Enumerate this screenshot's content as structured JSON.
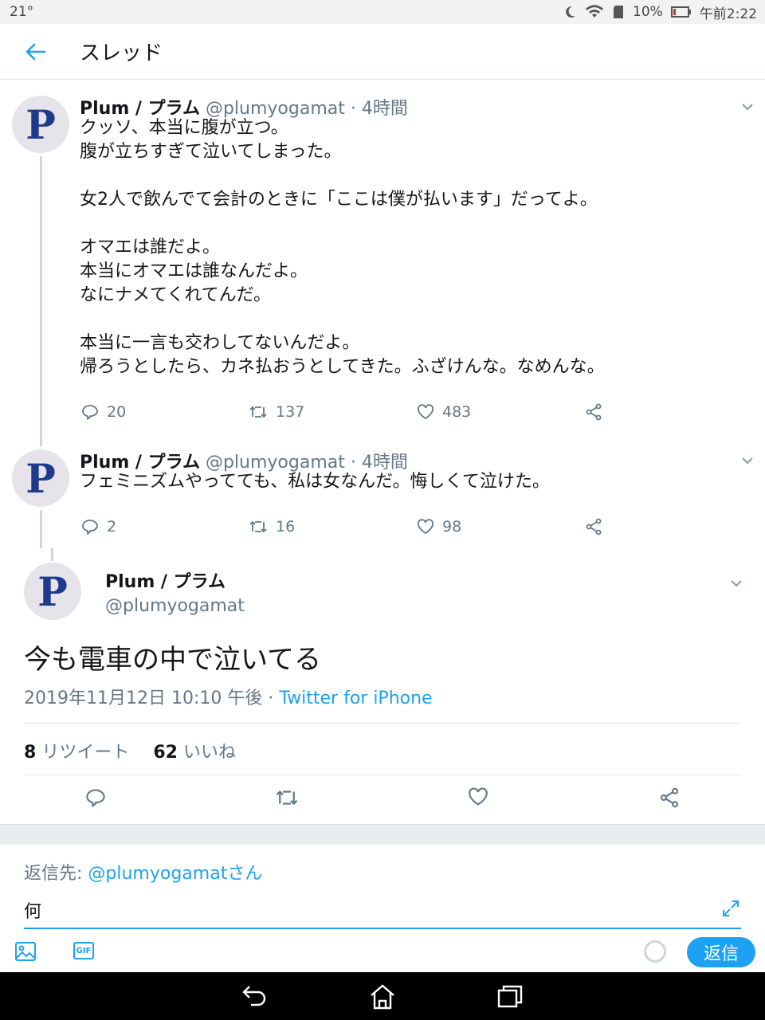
{
  "status_bar": {
    "temperature": "21°",
    "battery": "10%",
    "time": "午前2:22"
  },
  "header": {
    "title": "スレッド"
  },
  "colors": {
    "accent": "#1da1f2",
    "text": "#14171a",
    "muted": "#657786",
    "border": "#e1e8ed"
  },
  "tweets": [
    {
      "avatar_letter": "P",
      "name": "Plum / プラム",
      "handle": "@plumyogamat",
      "time": "· 4時間",
      "text": "クッソ、本当に腹が立つ。\n腹が立ちすぎて泣いてしまった。\n\n女2人で飲んでて会計のときに「ここは僕が払います」だってよ。\n\nオマエは誰だよ。\n本当にオマエは誰なんだよ。\nなにナメてくれてんだ。\n\n本当に一言も交わしてないんだよ。\n帰ろうとしたら、カネ払おうとしてきた。ふざけんな。なめんな。",
      "replies": "20",
      "retweets": "137",
      "likes": "483"
    },
    {
      "avatar_letter": "P",
      "name": "Plum / プラム",
      "handle": "@plumyogamat",
      "time": "· 4時間",
      "text": "フェミニズムやってても、私は女なんだ。悔しくて泣けた。",
      "replies": "2",
      "retweets": "16",
      "likes": "98"
    }
  ],
  "focused": {
    "avatar_letter": "P",
    "name": "Plum / プラム",
    "handle": "@plumyogamat",
    "text": "今も電車の中で泣いてる",
    "date": "2019年11月12日 10:10 午後 · ",
    "source": "Twitter for iPhone",
    "retweet_count": "8",
    "retweet_label": "リツイート",
    "like_count": "62",
    "like_label": "いいね"
  },
  "composer": {
    "reply_to_label": "返信先: ",
    "reply_to_mention": "@plumyogamatさん",
    "input_value": "何",
    "reply_button": "返信",
    "gif_label": "GIF"
  }
}
